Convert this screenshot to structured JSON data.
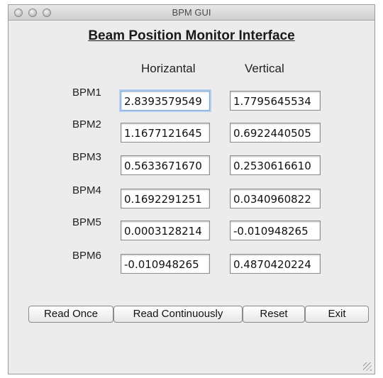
{
  "window": {
    "title": "BPM GUI"
  },
  "header": {
    "title": "Beam Position Monitor Interface"
  },
  "columns": {
    "horizontal": "Horizantal",
    "vertical": "Vertical"
  },
  "rows": [
    {
      "label": "BPM1",
      "horizontal": "2.8393579549",
      "vertical": "1.7795645534"
    },
    {
      "label": "BPM2",
      "horizontal": "1.1677121645",
      "vertical": "0.6922440505"
    },
    {
      "label": "BPM3",
      "horizontal": "0.5633671670",
      "vertical": "0.2530616610"
    },
    {
      "label": "BPM4",
      "horizontal": "0.1692291251",
      "vertical": "0.0340960822"
    },
    {
      "label": "BPM5",
      "horizontal": "0.0003128214",
      "vertical": "-0.010948265"
    },
    {
      "label": "BPM6",
      "horizontal": "-0.010948265",
      "vertical": "0.4870420224"
    }
  ],
  "buttons": {
    "read_once": "Read Once",
    "read_continuously": "Read Continuously",
    "reset": "Reset",
    "exit": "Exit"
  }
}
